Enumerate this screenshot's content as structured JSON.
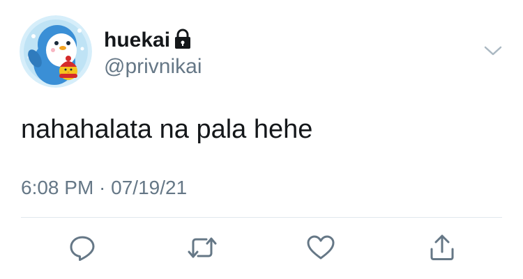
{
  "user": {
    "display_name": "huekai",
    "handle": "@privnikai",
    "avatar_icon": "penguin-avatar-icon",
    "protected_icon": "lock-icon"
  },
  "tweet": {
    "text": "nahahalata na pala hehe",
    "timestamp": "6:08 PM · 07/19/21"
  },
  "actions": [
    {
      "name": "reply",
      "icon": "reply-icon"
    },
    {
      "name": "retweet",
      "icon": "retweet-icon"
    },
    {
      "name": "like",
      "icon": "heart-icon"
    },
    {
      "name": "share",
      "icon": "share-icon"
    }
  ],
  "menu": {
    "icon": "chevron-down-icon"
  },
  "colors": {
    "text": "#14171a",
    "secondary": "#657786",
    "icon": "#657786",
    "divider": "#e1e8ed",
    "avatar_bg": "#bfe3f5"
  }
}
